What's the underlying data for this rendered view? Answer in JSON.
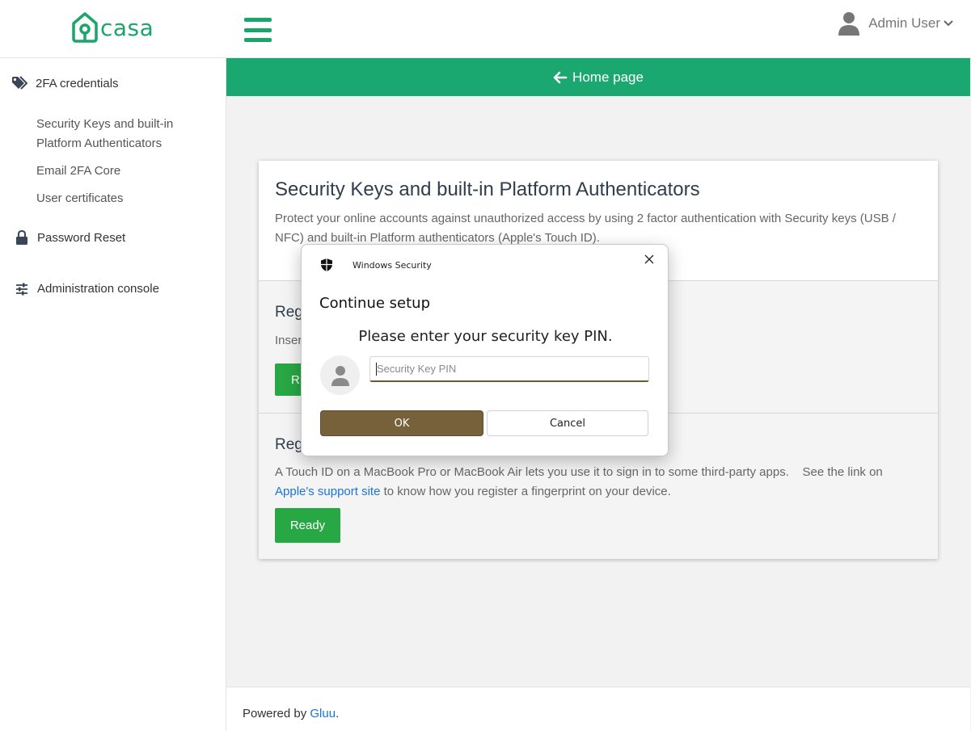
{
  "header": {
    "logo_text": "casa",
    "user_name": "Admin User"
  },
  "sidebar": {
    "sections": [
      {
        "label": "2FA credentials",
        "icon": "tags-icon"
      },
      {
        "label": "Password Reset",
        "icon": "lock-icon"
      },
      {
        "label": "Administration console",
        "icon": "sliders-icon"
      }
    ],
    "sub_items": [
      "Security Keys and built-in Platform Authenticators",
      "Email 2FA Core",
      "User certificates"
    ]
  },
  "banner": {
    "label": "Home page"
  },
  "card": {
    "title": "Security Keys and built-in Platform Authenticators",
    "description": "Protect your online accounts against unauthorized access by using 2 factor authentication with Security keys (USB / NFC) and built-in Platform authenticators (Apple's Touch ID).",
    "section1": {
      "title_partial": "Reg",
      "text_partial": "Inser",
      "button_partial": "R"
    },
    "section2": {
      "title_partial": "Reg",
      "text_before_link": "A Touch ID on a MacBook Pro or MacBook Air lets you use it to sign in to some third-party apps.    See the link on ",
      "link_text": "Apple's support site",
      "text_after_link": " to know how you register a fingerprint on your device.",
      "button_label": "Ready"
    }
  },
  "footer": {
    "prefix": "Powered by ",
    "link_text": "Gluu",
    "suffix": "."
  },
  "dialog": {
    "app_name": "Windows Security",
    "title": "Continue setup",
    "prompt": "Please enter your security key PIN.",
    "input_placeholder": "Security Key PIN",
    "ok_label": "OK",
    "cancel_label": "Cancel"
  },
  "colors": {
    "brand_green": "#1aa56a",
    "banner_green": "#1ba870",
    "button_green": "#28a745",
    "dialog_ok": "#76613a",
    "link_blue": "#1a73d9"
  }
}
